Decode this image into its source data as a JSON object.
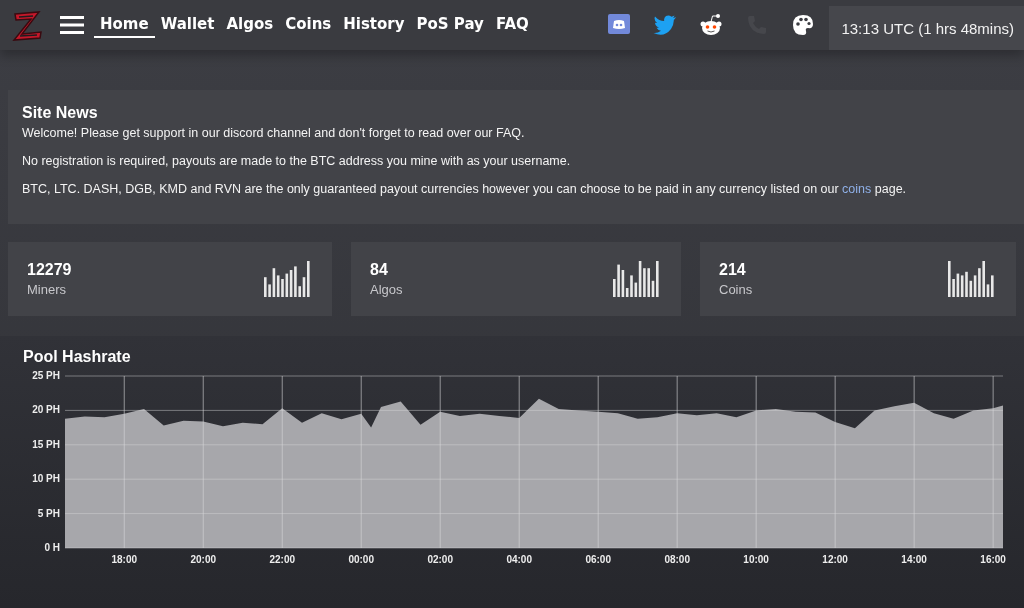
{
  "nav": {
    "items": [
      {
        "label": "Home",
        "selected": true
      },
      {
        "label": "Wallet",
        "selected": false
      },
      {
        "label": "Algos",
        "selected": false
      },
      {
        "label": "Coins",
        "selected": false
      },
      {
        "label": "History",
        "selected": false
      },
      {
        "label": "PoS Pay",
        "selected": false
      },
      {
        "label": "FAQ",
        "selected": false
      }
    ],
    "social": [
      {
        "kind": "discord"
      },
      {
        "kind": "twitter"
      },
      {
        "kind": "reddit"
      },
      {
        "kind": "phone",
        "disabled": true
      },
      {
        "kind": "palette"
      }
    ],
    "clock": "13:13 UTC (1 hrs 48mins)"
  },
  "news": {
    "title": "Site News",
    "paragraphs": [
      {
        "text": "Welcome! Please get support in our discord channel and don't forget to read over our FAQ."
      },
      {
        "text": "No registration is required, payouts are made to the BTC address you mine with as your username."
      },
      {
        "text": "BTC, LTC. DASH, DGB, KMD and RVN are the only guaranteed payout currencies however you can choose to be paid in any currency listed on our",
        "link": "coins",
        "after": "page."
      }
    ]
  },
  "stats": [
    {
      "value": "12279",
      "label": "Miners"
    },
    {
      "value": "84",
      "label": "Algos"
    },
    {
      "value": "214",
      "label": "Coins"
    }
  ],
  "hashrate": {
    "title": "Pool Hashrate",
    "chart_data": {
      "type": "area",
      "grid": true,
      "x": [
        "2000-01-01T16:30",
        "2000-01-01T17:00",
        "2000-01-01T17:30",
        "2000-01-01T18:00",
        "2000-01-01T18:30",
        "2000-01-01T19:00",
        "2000-01-01T19:30",
        "2000-01-01T20:00",
        "2000-01-01T20:30",
        "2000-01-01T21:00",
        "2000-01-01T21:30",
        "2000-01-01T22:00",
        "2000-01-01T22:30",
        "2000-01-01T23:00",
        "2000-01-01T23:30",
        "2000-01-02T00:00",
        "2000-01-02T00:15",
        "2000-01-02T00:30",
        "2000-01-02T01:00",
        "2000-01-02T01:30",
        "2000-01-02T02:00",
        "2000-01-02T02:30",
        "2000-01-02T03:00",
        "2000-01-02T03:30",
        "2000-01-02T04:00",
        "2000-01-02T04:30",
        "2000-01-02T05:00",
        "2000-01-02T05:30",
        "2000-01-02T06:00",
        "2000-01-02T06:30",
        "2000-01-02T07:00",
        "2000-01-02T07:30",
        "2000-01-02T08:00",
        "2000-01-02T08:30",
        "2000-01-02T09:00",
        "2000-01-02T09:30",
        "2000-01-02T10:00",
        "2000-01-02T10:30",
        "2000-01-02T11:00",
        "2000-01-02T11:30",
        "2000-01-02T12:00",
        "2000-01-02T12:30",
        "2000-01-02T13:00",
        "2000-01-02T13:30",
        "2000-01-02T14:00",
        "2000-01-02T14:30",
        "2000-01-02T15:00",
        "2000-01-02T15:30",
        "2000-01-02T16:00",
        "2000-01-02T16:15"
      ],
      "series": [
        {
          "color": "#a7a7ab",
          "values": [
            18.8,
            19.1,
            19.0,
            19.5,
            20.2,
            17.8,
            18.5,
            18.4,
            17.7,
            18.2,
            18.0,
            20.3,
            18.2,
            19.6,
            18.7,
            19.5,
            17.5,
            20.5,
            21.3,
            17.9,
            19.8,
            19.2,
            19.5,
            19.2,
            18.9,
            21.7,
            20.2,
            20.0,
            19.8,
            19.6,
            18.8,
            19.0,
            19.6,
            19.3,
            19.6,
            19.0,
            20.0,
            20.2,
            19.8,
            19.7,
            18.3,
            17.4,
            20.0,
            20.6,
            21.1,
            19.6,
            18.8,
            20.0,
            20.3,
            20.7
          ]
        }
      ],
      "xlim": [
        "2000-01-01T16:30",
        "2000-01-02T16:15"
      ],
      "ylim": [
        0,
        25
      ],
      "xticks": [
        {
          "value": "2000-01-01T18:00",
          "label": "18:00"
        },
        {
          "value": "2000-01-01T20:00",
          "label": "20:00"
        },
        {
          "value": "2000-01-01T22:00",
          "label": "22:00"
        },
        {
          "value": "2000-01-02T00:00",
          "label": "00:00"
        },
        {
          "value": "2000-01-02T02:00",
          "label": "02:00"
        },
        {
          "value": "2000-01-02T04:00",
          "label": "04:00"
        },
        {
          "value": "2000-01-02T06:00",
          "label": "06:00"
        },
        {
          "value": "2000-01-02T08:00",
          "label": "08:00"
        },
        {
          "value": "2000-01-02T10:00",
          "label": "10:00"
        },
        {
          "value": "2000-01-02T12:00",
          "label": "12:00"
        },
        {
          "value": "2000-01-02T14:00",
          "label": "14:00"
        },
        {
          "value": "2000-01-02T16:00",
          "label": "16:00"
        }
      ],
      "yticks": [
        {
          "value": 0,
          "label": "0 H"
        },
        {
          "value": 5,
          "label": "5 PH"
        },
        {
          "value": 10,
          "label": "10 PH"
        },
        {
          "value": 15,
          "label": "15 PH"
        },
        {
          "value": 20,
          "label": "20 PH"
        },
        {
          "value": 25,
          "label": "25 PH"
        }
      ]
    }
  }
}
